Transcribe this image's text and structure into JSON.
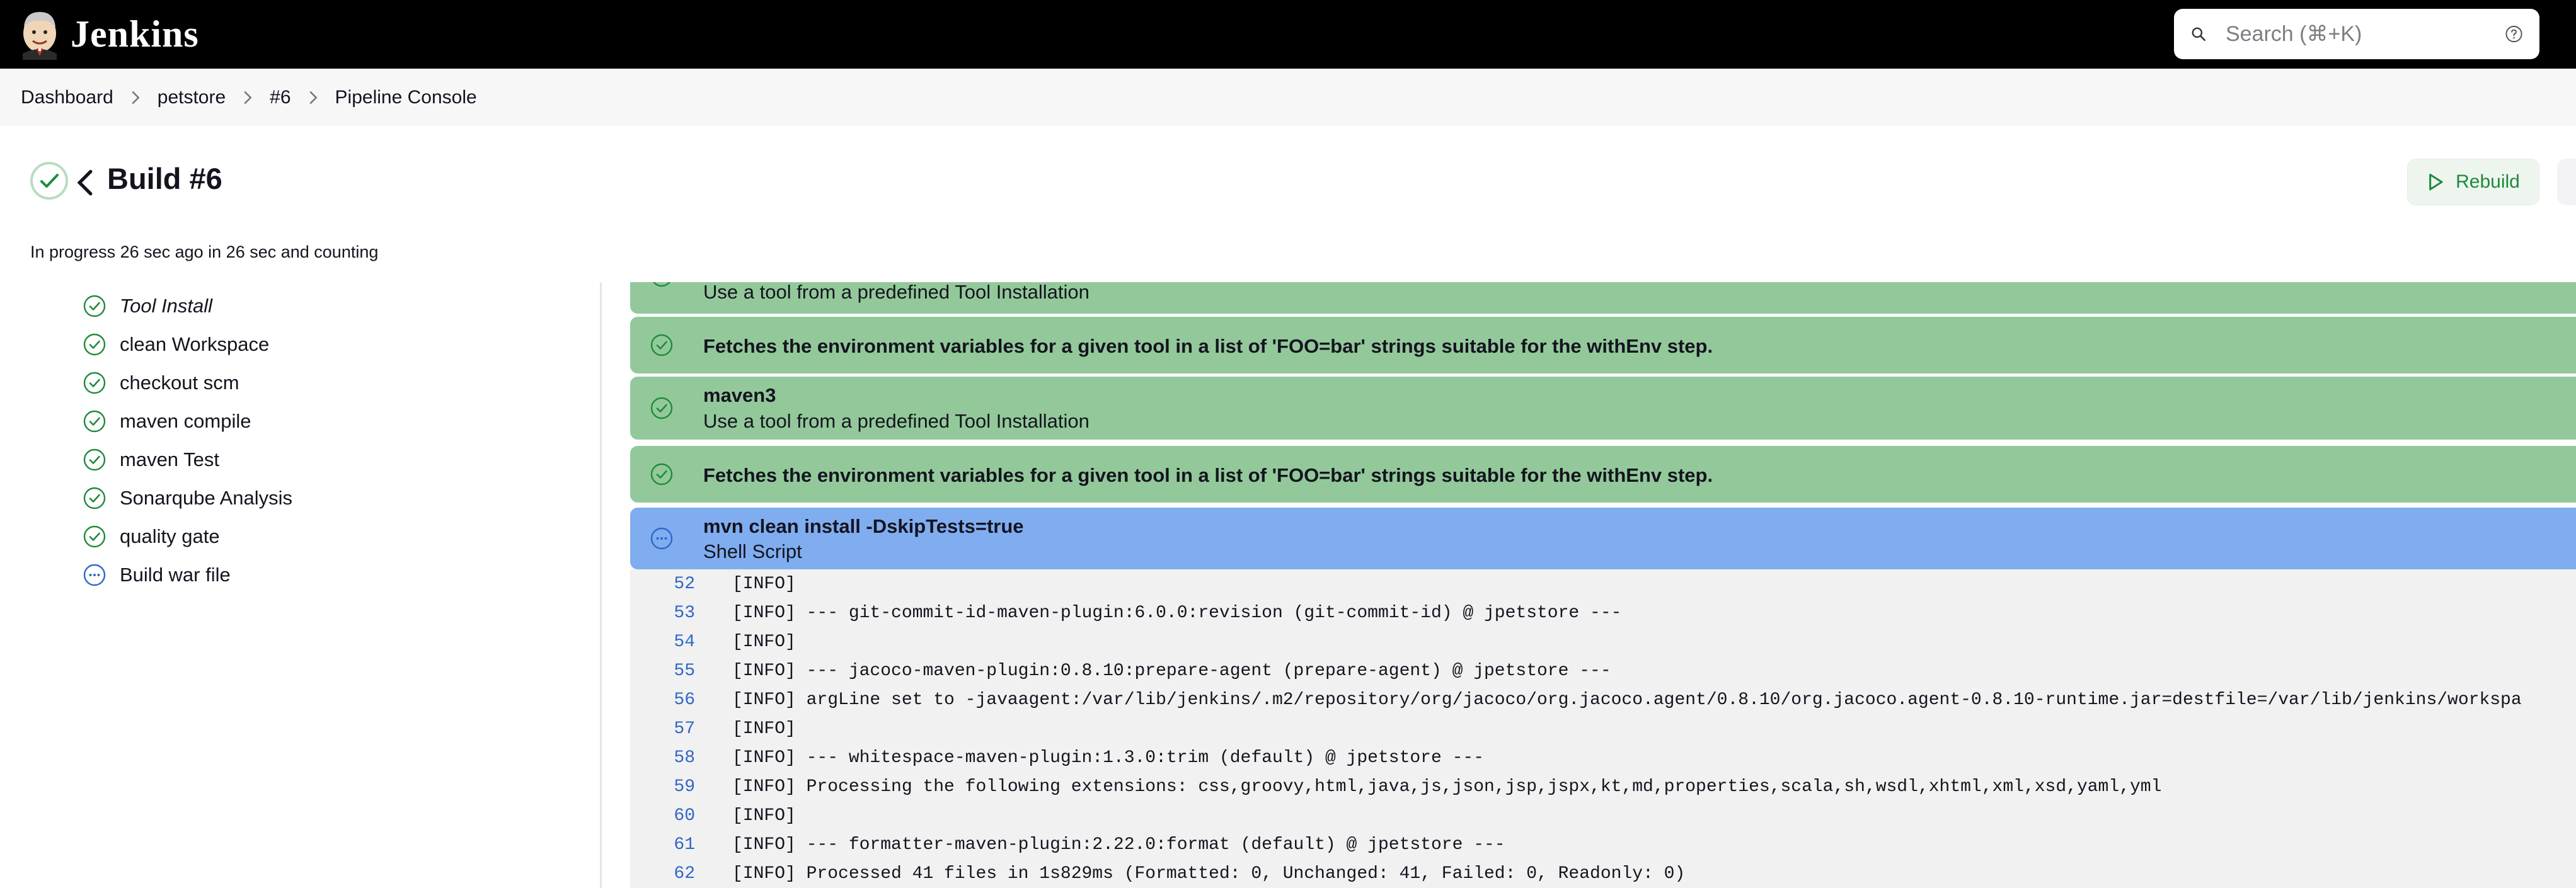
{
  "header": {
    "brand_name": "Jenkins",
    "search_placeholder": "Search (⌘+K)"
  },
  "breadcrumb": [
    "Dashboard",
    "petstore",
    "#6",
    "Pipeline Console"
  ],
  "build": {
    "title": "Build #6",
    "status_text": "In progress 26 sec ago in 26 sec and counting",
    "rebuild_label": "Rebuild"
  },
  "stages": [
    {
      "label": "Tool Install",
      "status": "success",
      "selected": true
    },
    {
      "label": "clean Workspace",
      "status": "success"
    },
    {
      "label": "checkout scm",
      "status": "success"
    },
    {
      "label": "maven compile",
      "status": "success"
    },
    {
      "label": "maven Test",
      "status": "success"
    },
    {
      "label": "Sonarqube Analysis",
      "status": "success"
    },
    {
      "label": "quality gate",
      "status": "success"
    },
    {
      "label": "Build war file",
      "status": "running"
    }
  ],
  "steps": [
    {
      "title": "",
      "description": "Use a tool from a predefined Tool Installation",
      "status": "success"
    },
    {
      "title": "Fetches the environment variables for a given tool in a list of 'FOO=bar' strings suitable for the withEnv step.",
      "description": "",
      "status": "success"
    },
    {
      "title": "maven3",
      "description": "Use a tool from a predefined Tool Installation",
      "status": "success"
    },
    {
      "title": "Fetches the environment variables for a given tool in a list of 'FOO=bar' strings suitable for the withEnv step.",
      "description": "",
      "status": "success"
    },
    {
      "title": "mvn clean install -DskipTests=true",
      "description": "Shell Script",
      "status": "running"
    }
  ],
  "console": [
    {
      "line": "52",
      "text": "[INFO]"
    },
    {
      "line": "53",
      "text": "[INFO] --- git-commit-id-maven-plugin:6.0.0:revision (git-commit-id) @ jpetstore ---"
    },
    {
      "line": "54",
      "text": "[INFO]"
    },
    {
      "line": "55",
      "text": "[INFO] --- jacoco-maven-plugin:0.8.10:prepare-agent (prepare-agent) @ jpetstore ---"
    },
    {
      "line": "56",
      "text": "[INFO] argLine set to -javaagent:/var/lib/jenkins/.m2/repository/org/jacoco/org.jacoco.agent/0.8.10/org.jacoco.agent-0.8.10-runtime.jar=destfile=/var/lib/jenkins/workspa"
    },
    {
      "line": "57",
      "text": "[INFO]"
    },
    {
      "line": "58",
      "text": "[INFO] --- whitespace-maven-plugin:1.3.0:trim (default) @ jpetstore ---"
    },
    {
      "line": "59",
      "text": "[INFO] Processing the following extensions: css,groovy,html,java,js,json,jsp,jspx,kt,md,properties,scala,sh,wsdl,xhtml,xml,xsd,yaml,yml"
    },
    {
      "line": "60",
      "text": "[INFO]"
    },
    {
      "line": "61",
      "text": "[INFO] --- formatter-maven-plugin:2.22.0:format (default) @ jpetstore ---"
    },
    {
      "line": "62",
      "text": "[INFO] Processed 41 files in 1s829ms (Formatted: 0, Unchanged: 41, Failed: 0, Readonly: 0)"
    }
  ],
  "colors": {
    "success": "#93c99a",
    "running": "#80adf0",
    "success_icon": "#1e8a3b",
    "running_icon": "#2f66c8"
  },
  "icons": {
    "success": "check-circle-icon",
    "running": "in-progress-dots-icon"
  }
}
